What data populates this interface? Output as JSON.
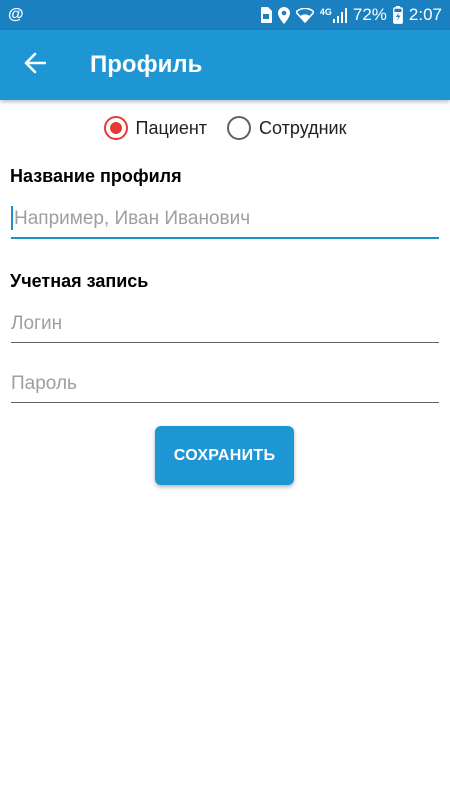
{
  "status_bar": {
    "left_icon": "at-icon",
    "left_text": "@",
    "network": "4G",
    "battery": "72%",
    "time": "2:07"
  },
  "app_bar": {
    "title": "Профиль",
    "back_icon": "arrow-left-icon"
  },
  "role": {
    "options": [
      {
        "label": "Пациент",
        "checked": true
      },
      {
        "label": "Сотрудник",
        "checked": false
      }
    ]
  },
  "profile_name": {
    "label": "Название профиля",
    "placeholder": "Например, Иван Иванович"
  },
  "account": {
    "label": "Учетная запись",
    "login_placeholder": "Логин",
    "password_placeholder": "Пароль"
  },
  "save_label": "СОХРАНИТЬ",
  "colors": {
    "status_bar": "#1b80c0",
    "app_bar": "#1e96d3",
    "radio_checked": "#e53935",
    "focus_line": "#1e8fc9"
  }
}
